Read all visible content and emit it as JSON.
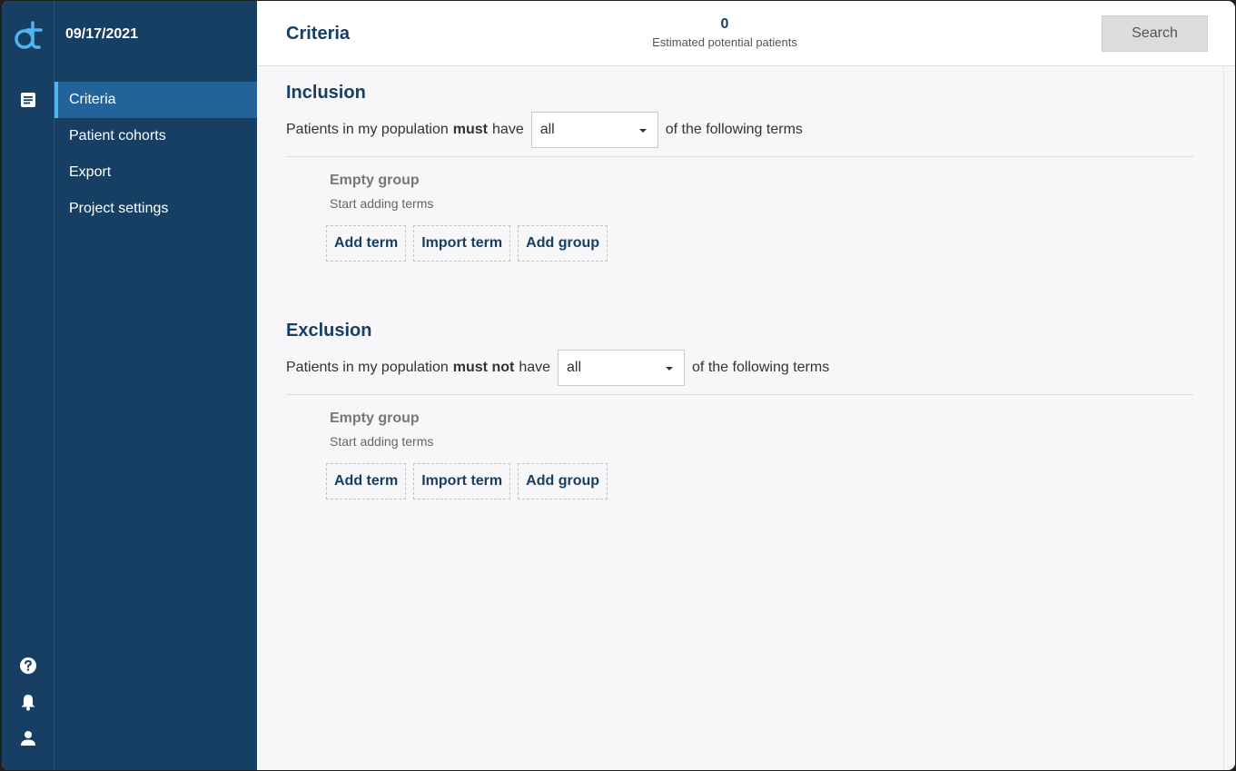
{
  "app": {
    "date": "09/17/2021",
    "page_title": "Criteria"
  },
  "sidebar": {
    "items": [
      {
        "label": "Criteria",
        "active": true
      },
      {
        "label": "Patient cohorts"
      },
      {
        "label": "Export"
      },
      {
        "label": "Project settings"
      }
    ]
  },
  "rail": {
    "icons": [
      "logo-icon",
      "document-icon",
      "help-icon",
      "bell-icon",
      "user-icon"
    ]
  },
  "header": {
    "count": "0",
    "count_label": "Estimated potential patients",
    "search_label": "Search"
  },
  "inclusion": {
    "title": "Inclusion",
    "prefix": "Patients in my population",
    "qualifier": "must",
    "verb": "have",
    "select_value": "all",
    "suffix": "of the following terms",
    "group_title": "Empty group",
    "group_sub": "Start adding terms",
    "buttons": [
      "Add term",
      "Import term",
      "Add group"
    ]
  },
  "exclusion": {
    "title": "Exclusion",
    "prefix": "Patients in my population",
    "qualifier": "must not",
    "verb": "have",
    "select_value": "all",
    "suffix": "of the following terms",
    "group_title": "Empty group",
    "group_sub": "Start adding terms",
    "buttons": [
      "Add term",
      "Import term",
      "Add group"
    ]
  },
  "colors": {
    "sidebar_bg": "#163f63",
    "active_item_bg": "#24629a",
    "active_indicator": "#4fb6f0",
    "primary_text": "#163f63"
  }
}
